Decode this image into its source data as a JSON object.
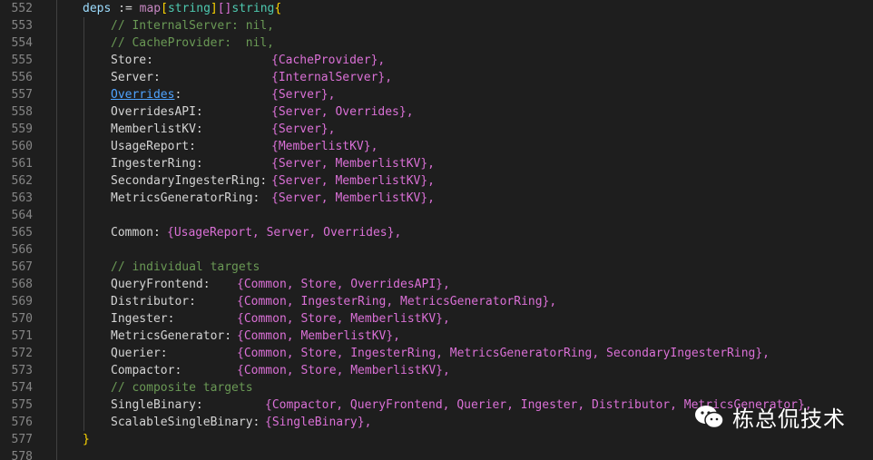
{
  "line_numbers": [
    "552",
    "553",
    "554",
    "555",
    "556",
    "557",
    "558",
    "559",
    "560",
    "561",
    "562",
    "563",
    "564",
    "565",
    "566",
    "567",
    "568",
    "569",
    "570",
    "571",
    "572",
    "573",
    "574",
    "575",
    "576",
    "577",
    "578"
  ],
  "code": {
    "l552": {
      "var": "deps",
      "assign": " := ",
      "map": "map",
      "open_b": "[",
      "key_type": "string",
      "close_b": "]",
      "slice": "[]",
      "elem_type": "string",
      "brace": "{"
    },
    "l553": "// InternalServer: nil,",
    "l554": "// CacheProvider:  nil,",
    "l555": {
      "key": "Store:",
      "val": "{CacheProvider},"
    },
    "l556": {
      "key": "Server:",
      "val": "{InternalServer},"
    },
    "l557": {
      "key": "Overrides",
      "colon": ":",
      "val": "{Server},"
    },
    "l558": {
      "key": "OverridesAPI:",
      "val": "{Server, Overrides},"
    },
    "l559": {
      "key": "MemberlistKV:",
      "val": "{Server},"
    },
    "l560": {
      "key": "UsageReport:",
      "val": "{MemberlistKV},"
    },
    "l561": {
      "key": "IngesterRing:",
      "val": "{Server, MemberlistKV},"
    },
    "l562": {
      "key": "SecondaryIngesterRing:",
      "val": "{Server, MemberlistKV},"
    },
    "l563": {
      "key": "MetricsGeneratorRing:",
      "val": "{Server, MemberlistKV},"
    },
    "l565": {
      "key": "Common:",
      "val": "{UsageReport, Server, Overrides},"
    },
    "l567": "// individual targets",
    "l568": {
      "key": "QueryFrontend:",
      "val": "{Common, Store, OverridesAPI},"
    },
    "l569": {
      "key": "Distributor:",
      "val": "{Common, IngesterRing, MetricsGeneratorRing},"
    },
    "l570": {
      "key": "Ingester:",
      "val": "{Common, Store, MemberlistKV},"
    },
    "l571": {
      "key": "MetricsGenerator:",
      "val": "{Common, MemberlistKV},"
    },
    "l572": {
      "key": "Querier:",
      "val": "{Common, Store, IngesterRing, MetricsGeneratorRing, SecondaryIngesterRing},"
    },
    "l573": {
      "key": "Compactor:",
      "val": "{Common, Store, MemberlistKV},"
    },
    "l574": "// composite targets",
    "l575": {
      "key": "SingleBinary:",
      "val": "{Compactor, QueryFrontend, Querier, Ingester, Distributor, MetricsGenerator},"
    },
    "l576": {
      "key": "ScalableSingleBinary:",
      "val": "{SingleBinary},"
    },
    "l577": "}"
  },
  "watermark": {
    "text": "栋总侃技术",
    "icon": "wechat-icon"
  },
  "colors": {
    "background": "#1e1e1e",
    "comment": "#6a9955",
    "variable": "#9cdcfe",
    "type": "#4ec9b0",
    "keyword": "#c586c0",
    "bracket_gold": "#ffd700",
    "bracket_purple": "#da70d6",
    "bracket_blue": "#179fff",
    "line_number": "#858585"
  }
}
